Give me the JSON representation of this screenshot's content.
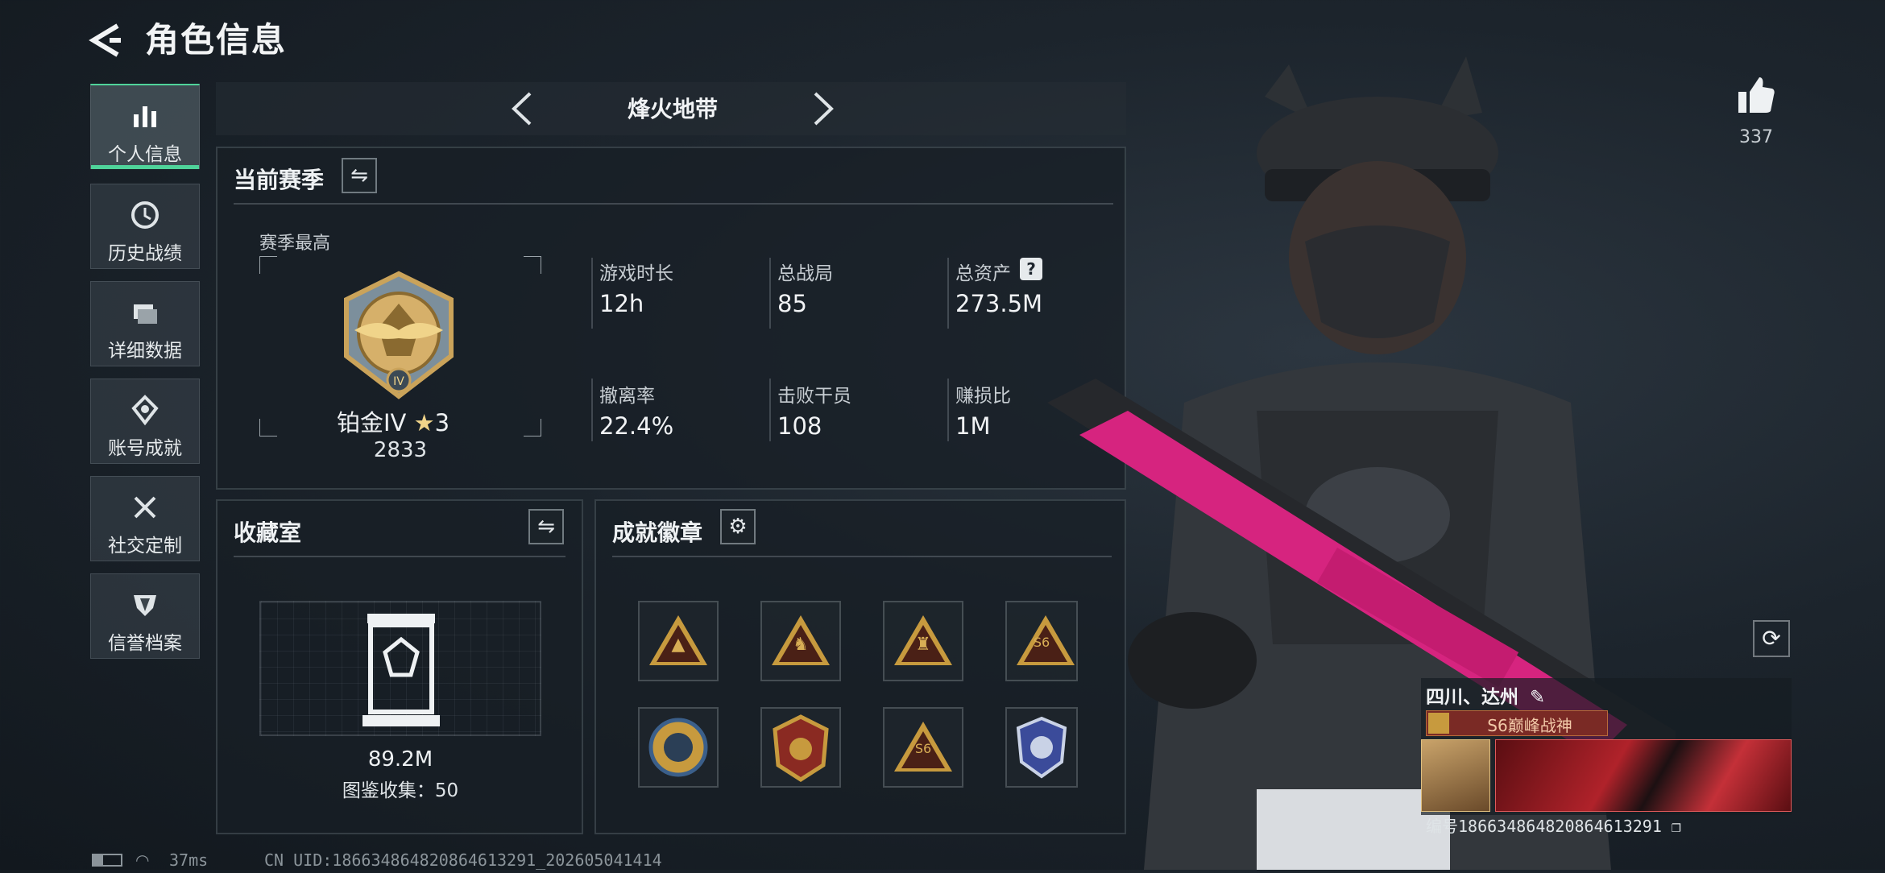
{
  "header": {
    "title": "角色信息"
  },
  "sidebar": {
    "items": [
      {
        "label": "个人信息",
        "icon": "bar-chart-icon",
        "active": true
      },
      {
        "label": "历史战绩",
        "icon": "clock-icon"
      },
      {
        "label": "详细数据",
        "icon": "folders-icon"
      },
      {
        "label": "账号成就",
        "icon": "medal-icon"
      },
      {
        "label": "社交定制",
        "icon": "tools-icon"
      },
      {
        "label": "信誉档案",
        "icon": "shield-icon"
      }
    ]
  },
  "mode": {
    "title": "烽火地带"
  },
  "season": {
    "title": "当前赛季",
    "best_label": "赛季最高",
    "rank_name": "铂金IV",
    "rank_stars": "3",
    "rank_score": "2833",
    "stats": [
      {
        "label": "游戏时长",
        "value": "12h"
      },
      {
        "label": "总战局",
        "value": "85"
      },
      {
        "label": "总资产",
        "value": "273.5M",
        "help": "?"
      },
      {
        "label": "撤离率",
        "value": "22.4%"
      },
      {
        "label": "击败干员",
        "value": "108"
      },
      {
        "label": "赚损比",
        "value": "1M"
      }
    ]
  },
  "collection": {
    "title": "收藏室",
    "value": "89.2M",
    "caption": "图鉴收集：50"
  },
  "achievements": {
    "title": "成就徽章",
    "badges": [
      {
        "icon": "triangle-badge-icon",
        "glyph": "▲"
      },
      {
        "icon": "triangle-soldier-badge-icon",
        "glyph": "♞"
      },
      {
        "icon": "triangle-squad-badge-icon",
        "glyph": "♜"
      },
      {
        "icon": "triangle-s6-badge-icon",
        "glyph": "S6"
      },
      {
        "icon": "round-gold-badge-icon",
        "glyph": "✪"
      },
      {
        "icon": "crest-badge-icon",
        "glyph": "✦"
      },
      {
        "icon": "triangle-s6-badge-icon",
        "glyph": "S6"
      },
      {
        "icon": "blue-shield-badge-icon",
        "glyph": "◈"
      }
    ]
  },
  "likes": {
    "count": "337"
  },
  "profile": {
    "location": "四川、达州",
    "title_badge": "S6巅峰战神",
    "id_label": "编号1866348648208646132​91"
  },
  "status": {
    "latency": "37ms",
    "uid": "CN UID:18663486482086461329​1_202605041414"
  },
  "colors": {
    "accent": "#4fd39a",
    "gold": "#c79a3e",
    "magenta": "#d6247f"
  }
}
